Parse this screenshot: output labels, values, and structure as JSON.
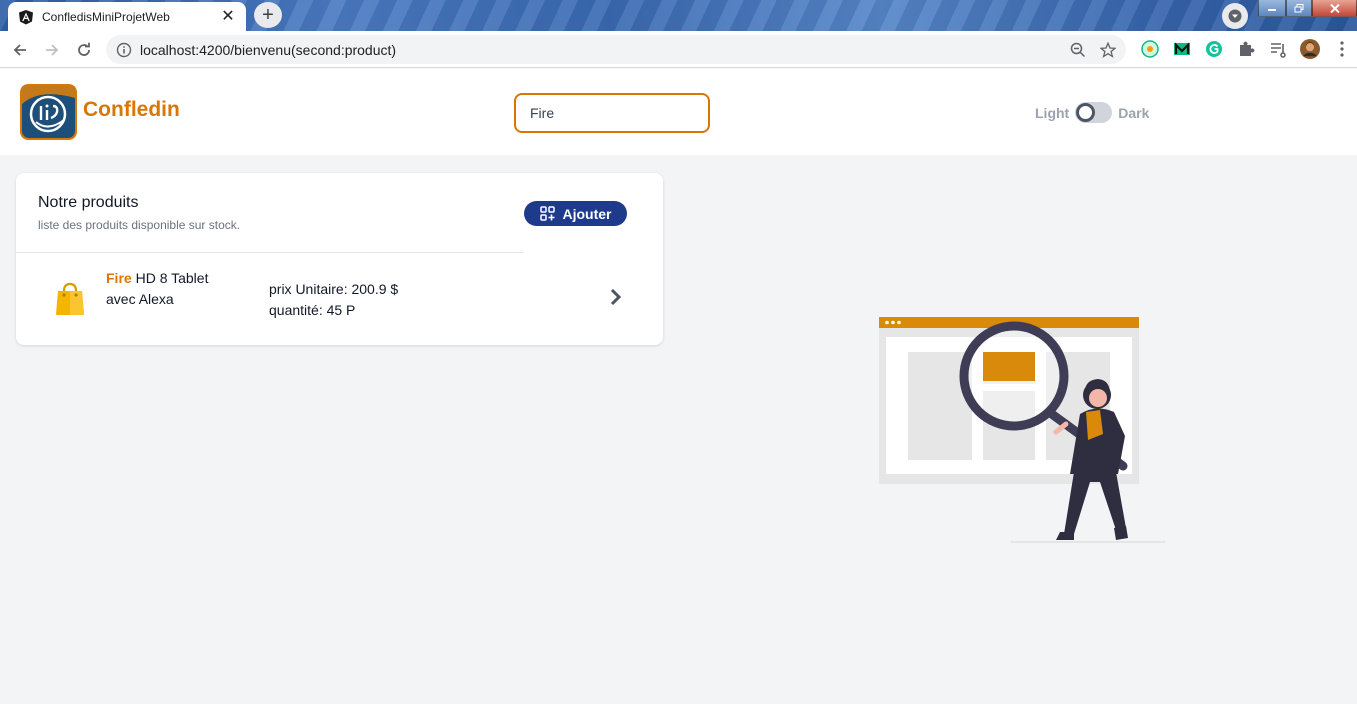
{
  "browser": {
    "tab_title": "ConfledisMiniProjetWeb",
    "url": "localhost:4200/bienvenu(second:product)"
  },
  "header": {
    "brand": "Confledin",
    "search_value": "Fire",
    "theme_light_label": "Light",
    "theme_dark_label": "Dark"
  },
  "products_section": {
    "title": "Notre produits",
    "subtitle": "liste des produits disponible sur stock.",
    "add_button_label": "Ajouter",
    "items": [
      {
        "name_highlight": "Fire",
        "name_rest": " HD 8 Tablet avec Alexa",
        "price_text": "prix Unitaire: 200.9 $",
        "quantity_text": "quantité: 45 P"
      }
    ]
  },
  "colors": {
    "accent": "#d97706",
    "primary_button": "#1e3a8a",
    "background": "#f3f4f6"
  }
}
